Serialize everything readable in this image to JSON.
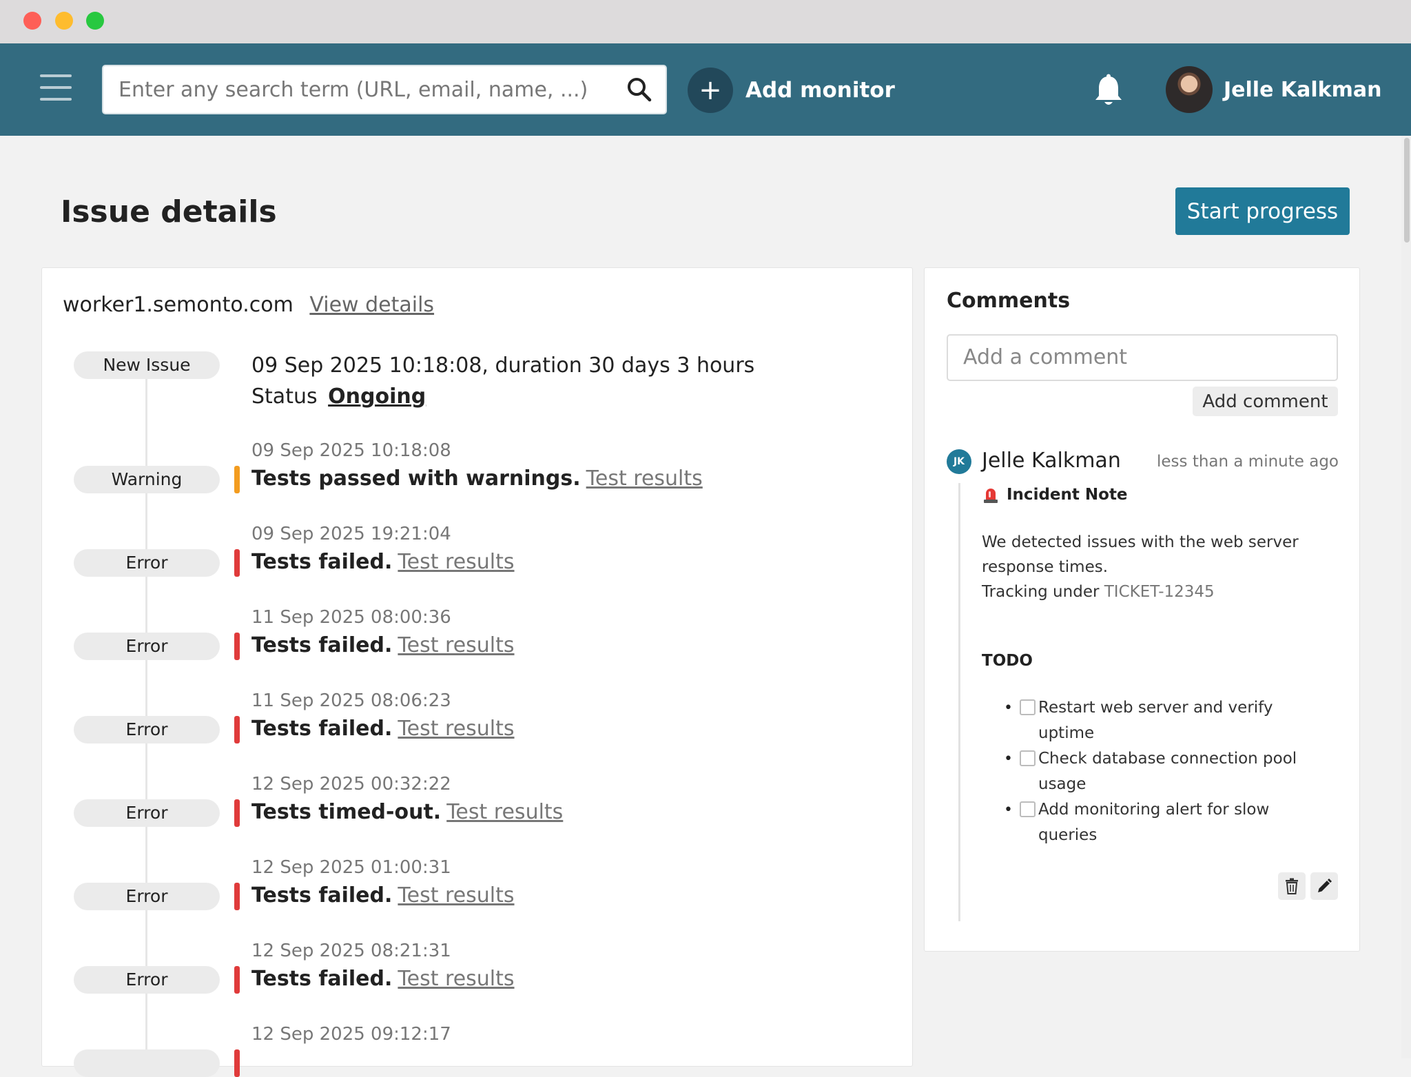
{
  "header": {
    "search_placeholder": "Enter any search term (URL, email, name, ...)",
    "add_monitor_label": "Add monitor",
    "add_symbol": "+",
    "user_name": "Jelle Kalkman"
  },
  "page": {
    "title": "Issue details",
    "start_progress_label": "Start progress"
  },
  "issue": {
    "host": "worker1.semonto.com",
    "view_details": "View details",
    "first": {
      "badge": "New Issue",
      "line": "09 Sep 2025 10:18:08, duration 30 days 3 hours",
      "status_label": "Status",
      "status_value": "Ongoing"
    },
    "events": [
      {
        "badge": "Warning",
        "time": "09 Sep 2025 10:18:08",
        "message": "Tests passed with warnings.",
        "link": "Test results"
      },
      {
        "badge": "Error",
        "time": "09 Sep 2025 19:21:04",
        "message": "Tests failed.",
        "link": "Test results"
      },
      {
        "badge": "Error",
        "time": "11 Sep 2025 08:00:36",
        "message": "Tests failed.",
        "link": "Test results"
      },
      {
        "badge": "Error",
        "time": "11 Sep 2025 08:06:23",
        "message": "Tests failed.",
        "link": "Test results"
      },
      {
        "badge": "Error",
        "time": "12 Sep 2025 00:32:22",
        "message": "Tests timed-out.",
        "link": "Test results"
      },
      {
        "badge": "Error",
        "time": "12 Sep 2025 01:00:31",
        "message": "Tests failed.",
        "link": "Test results"
      },
      {
        "badge": "Error",
        "time": "12 Sep 2025 08:21:31",
        "message": "Tests failed.",
        "link": "Test results"
      },
      {
        "badge": "",
        "time": "12 Sep 2025 09:12:17",
        "message": "",
        "link": ""
      }
    ]
  },
  "comments": {
    "title": "Comments",
    "input_placeholder": "Add a comment",
    "add_button": "Add comment",
    "item": {
      "initials": "JK",
      "author": "Jelle Kalkman",
      "time": "less than a minute ago",
      "note_title": "Incident Note",
      "body_line1": "We detected issues with the web server",
      "body_line2": "response times.",
      "tracking_prefix": "Tracking under",
      "ticket": "TICKET-12345",
      "todo_heading": "TODO",
      "todos": [
        {
          "line1": "Restart web server and verify",
          "line2": "uptime",
          "checked": false
        },
        {
          "line1": "Check database connection pool",
          "line2": "usage",
          "checked": false
        },
        {
          "line1": "Add monitoring alert for slow",
          "line2": "queries",
          "checked": false
        }
      ]
    }
  },
  "colors": {
    "nav_bg": "#336b80",
    "primary_button": "#217a99",
    "warning": "#f39c1f",
    "error": "#e03b3b"
  },
  "icons": {
    "menu": "hamburger-menu-icon",
    "search": "search-icon",
    "add": "plus-icon",
    "notifications": "bell-icon",
    "note": "siren-icon",
    "delete": "trash-icon",
    "edit": "pencil-icon"
  }
}
